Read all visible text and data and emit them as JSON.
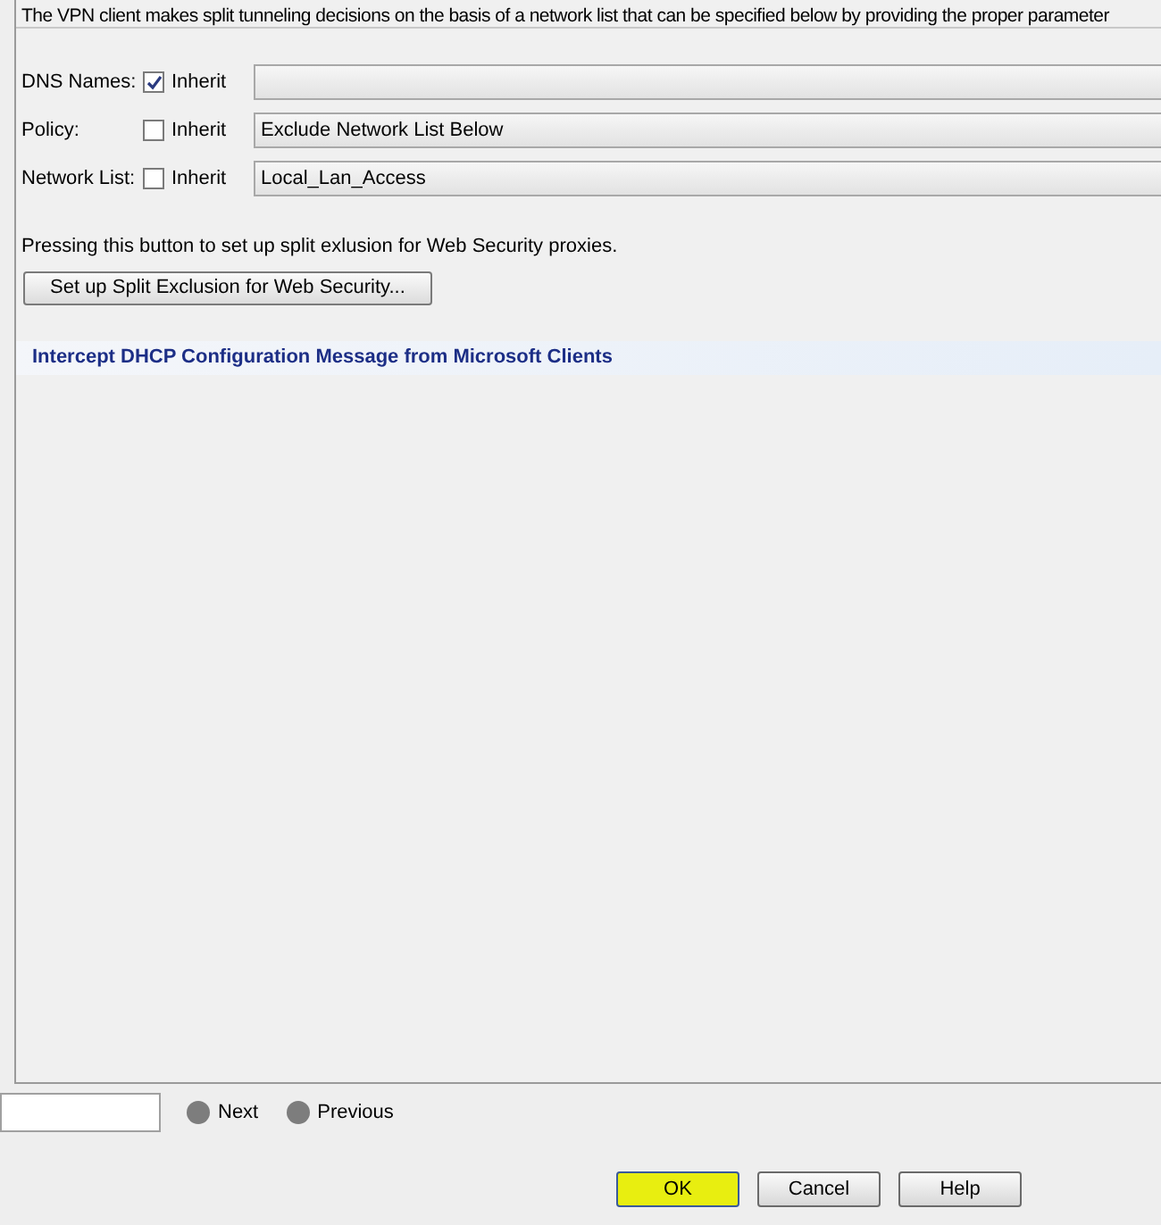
{
  "intro": "The VPN client makes split tunneling decisions on the basis of a network list that can be specified below by providing the proper parameter",
  "rows": [
    {
      "label": "DNS Names:",
      "inherit_label": "Inherit",
      "checked": true,
      "value": ""
    },
    {
      "label": "Policy:",
      "inherit_label": "Inherit",
      "checked": false,
      "value": "Exclude Network List Below"
    },
    {
      "label": "Network List:",
      "inherit_label": "Inherit",
      "checked": false,
      "value": "Local_Lan_Access"
    }
  ],
  "exclusion_note": "Pressing this button to set up split exlusion for Web Security proxies.",
  "exclusion_button": "Set up Split Exclusion for Web Security...",
  "section_header": "Intercept DHCP Configuration Message from Microsoft Clients",
  "find": {
    "next": "Next",
    "previous": "Previous"
  },
  "buttons": [
    {
      "label": "OK",
      "highlighted": true
    },
    {
      "label": "Cancel",
      "highlighted": false
    },
    {
      "label": "Help",
      "highlighted": false
    }
  ]
}
